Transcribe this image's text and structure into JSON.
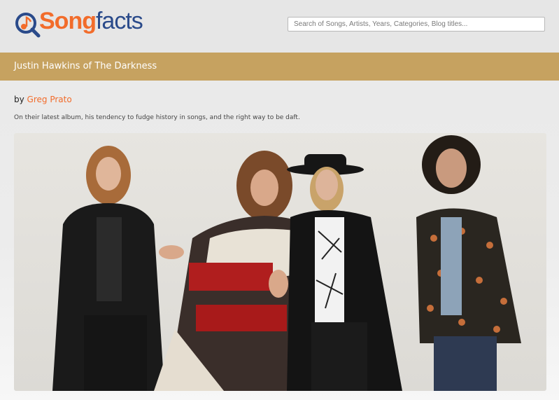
{
  "header": {
    "logo": {
      "brand_accent": "Song",
      "brand_rest": "facts"
    },
    "search": {
      "placeholder": "Search of Songs, Artists, Years, Categories, Blog titles..."
    }
  },
  "article": {
    "title": "Justin Hawkins of The Darkness",
    "by_prefix": "by",
    "author": "Greg Prato",
    "summary": "On their latest album, his tendency to fudge history in songs, and the right way to be daft."
  },
  "colors": {
    "accent": "#f26c2b",
    "brand_blue": "#2a4a8a",
    "title_bar": "#c6a260"
  }
}
